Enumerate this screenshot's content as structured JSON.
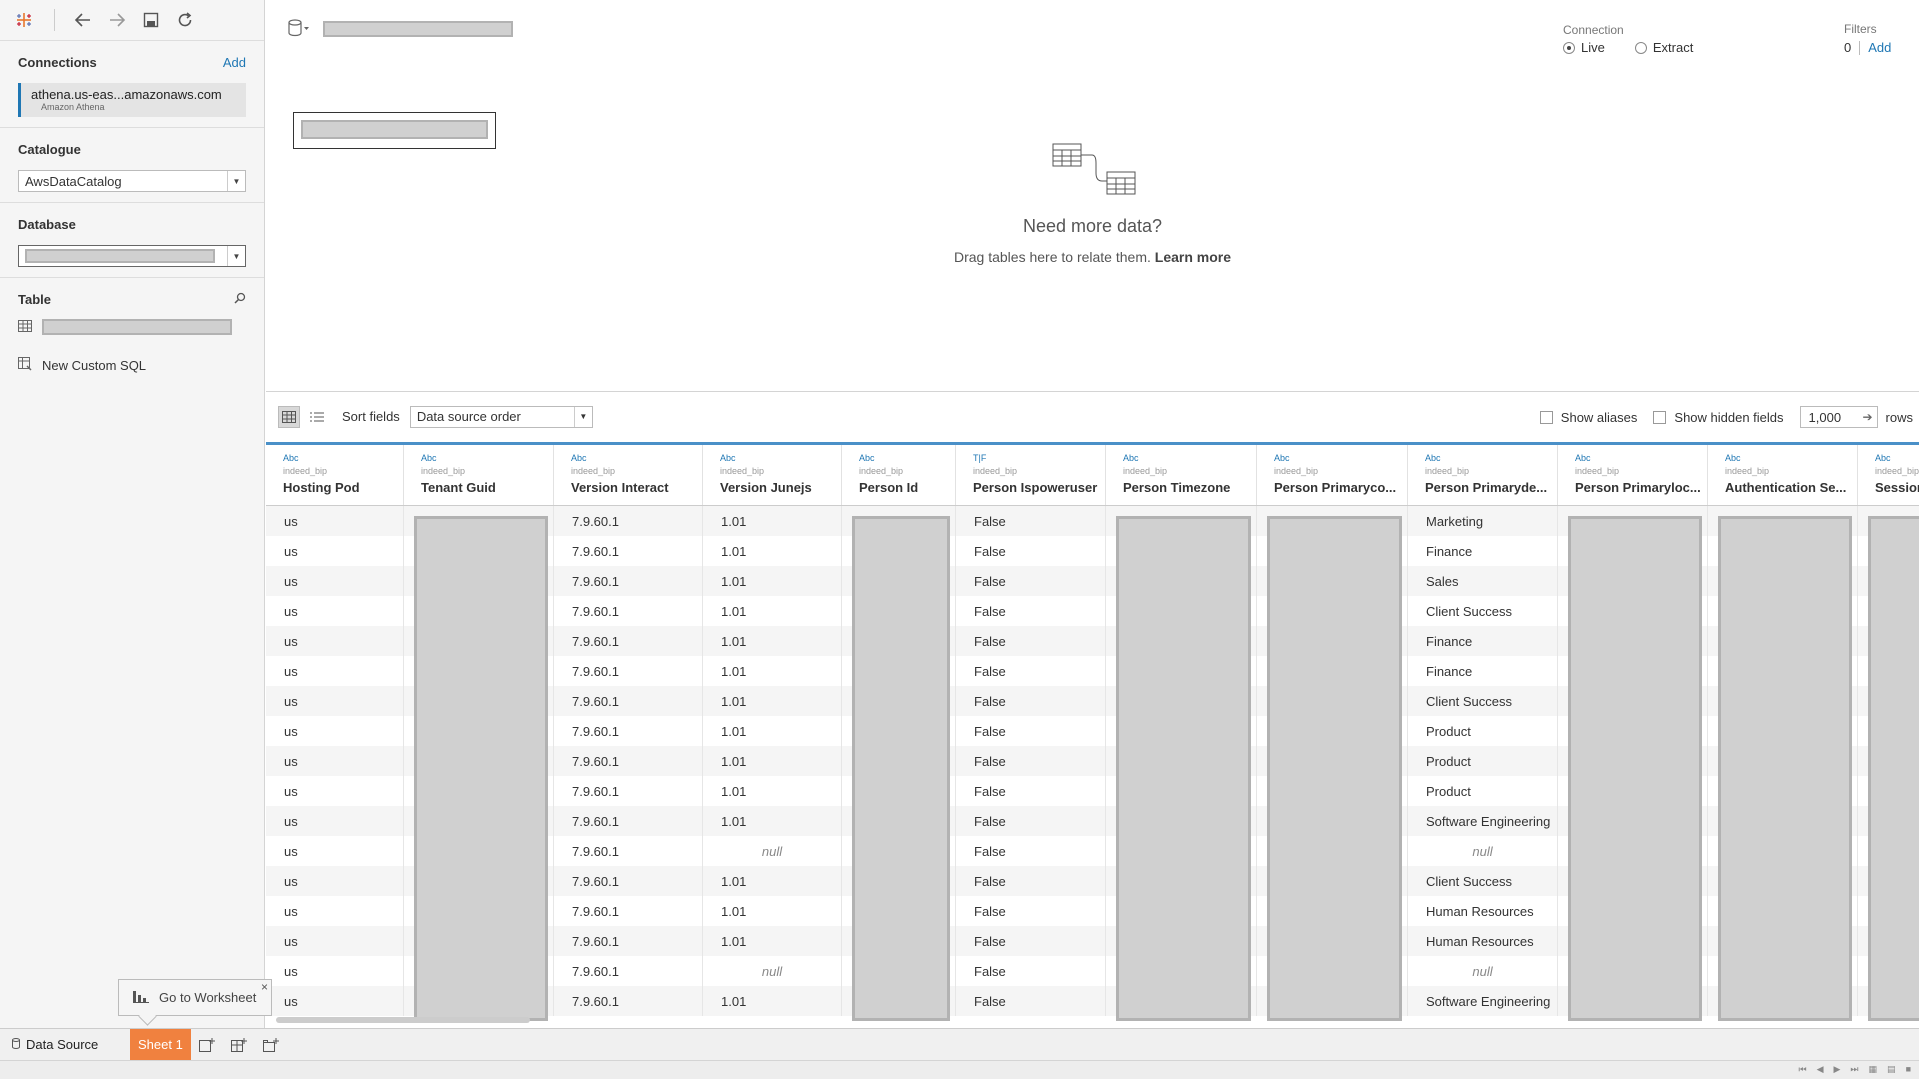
{
  "left_pane": {
    "connections_title": "Connections",
    "connections_add": "Add",
    "connection_name": "athena.us-eas...amazonaws.com",
    "connection_type": "Amazon Athena",
    "catalogue_title": "Catalogue",
    "catalogue_value": "AwsDataCatalog",
    "database_title": "Database",
    "table_title": "Table",
    "new_custom_sql": "New Custom SQL"
  },
  "canvas": {
    "connection_label": "Connection",
    "live_label": "Live",
    "extract_label": "Extract",
    "filters_label": "Filters",
    "filters_count": "0",
    "filters_add": "Add",
    "need_more_title": "Need more data?",
    "need_more_text": "Drag tables here to relate them.",
    "learn_more": "Learn more"
  },
  "grid_toolbar": {
    "sort_label": "Sort fields",
    "sort_value": "Data source order",
    "show_aliases": "Show aliases",
    "show_hidden": "Show hidden fields",
    "rows_value": "1,000",
    "rows_label": "rows"
  },
  "columns": [
    {
      "type": "Abc",
      "source": "indeed_bip",
      "name": "Hosting Pod"
    },
    {
      "type": "Abc",
      "source": "indeed_bip",
      "name": "Tenant Guid"
    },
    {
      "type": "Abc",
      "source": "indeed_bip",
      "name": "Version Interact"
    },
    {
      "type": "Abc",
      "source": "indeed_bip",
      "name": "Version Junejs"
    },
    {
      "type": "Abc",
      "source": "indeed_bip",
      "name": "Person Id"
    },
    {
      "type": "T|F",
      "source": "indeed_bip",
      "name": "Person Ispoweruser"
    },
    {
      "type": "Abc",
      "source": "indeed_bip",
      "name": "Person Timezone"
    },
    {
      "type": "Abc",
      "source": "indeed_bip",
      "name": "Person Primaryco..."
    },
    {
      "type": "Abc",
      "source": "indeed_bip",
      "name": "Person Primaryde..."
    },
    {
      "type": "Abc",
      "source": "indeed_bip",
      "name": "Person Primaryloc..."
    },
    {
      "type": "Abc",
      "source": "indeed_bip",
      "name": "Authentication Se..."
    },
    {
      "type": "Abc",
      "source": "indeed_bip",
      "name": "Session In"
    }
  ],
  "rows": [
    [
      "us",
      "",
      "7.9.60.1",
      "1.01",
      "",
      "False",
      "",
      "",
      "Marketing",
      "",
      "",
      ""
    ],
    [
      "us",
      "",
      "7.9.60.1",
      "1.01",
      "",
      "False",
      "",
      "",
      "Finance",
      "",
      "",
      ""
    ],
    [
      "us",
      "",
      "7.9.60.1",
      "1.01",
      "",
      "False",
      "",
      "",
      "Sales",
      "",
      "",
      ""
    ],
    [
      "us",
      "",
      "7.9.60.1",
      "1.01",
      "",
      "False",
      "",
      "",
      "Client Success",
      "",
      "",
      ""
    ],
    [
      "us",
      "",
      "7.9.60.1",
      "1.01",
      "",
      "False",
      "",
      "",
      "Finance",
      "",
      "",
      ""
    ],
    [
      "us",
      "",
      "7.9.60.1",
      "1.01",
      "",
      "False",
      "",
      "",
      "Finance",
      "",
      "",
      ""
    ],
    [
      "us",
      "",
      "7.9.60.1",
      "1.01",
      "",
      "False",
      "",
      "",
      "Client Success",
      "",
      "",
      ""
    ],
    [
      "us",
      "",
      "7.9.60.1",
      "1.01",
      "",
      "False",
      "",
      "",
      "Product",
      "",
      "",
      ""
    ],
    [
      "us",
      "",
      "7.9.60.1",
      "1.01",
      "",
      "False",
      "",
      "",
      "Product",
      "",
      "",
      ""
    ],
    [
      "us",
      "",
      "7.9.60.1",
      "1.01",
      "",
      "False",
      "",
      "",
      "Product",
      "",
      "",
      ""
    ],
    [
      "us",
      "",
      "7.9.60.1",
      "1.01",
      "",
      "False",
      "",
      "",
      "Software Engineering",
      "",
      "",
      ""
    ],
    [
      "us",
      "",
      "7.9.60.1",
      "null",
      "",
      "False",
      "",
      "",
      "null",
      "",
      "",
      ""
    ],
    [
      "us",
      "",
      "7.9.60.1",
      "1.01",
      "",
      "False",
      "",
      "",
      "Client Success",
      "",
      "",
      ""
    ],
    [
      "us",
      "",
      "7.9.60.1",
      "1.01",
      "",
      "False",
      "",
      "",
      "Human Resources",
      "",
      "",
      ""
    ],
    [
      "us",
      "",
      "7.9.60.1",
      "1.01",
      "",
      "False",
      "",
      "",
      "Human Resources",
      "",
      "",
      ""
    ],
    [
      "us",
      "",
      "7.9.60.1",
      "null",
      "",
      "False",
      "",
      "",
      "null",
      "",
      "",
      ""
    ],
    [
      "us",
      "",
      "7.9.60.1",
      "1.01",
      "",
      "False",
      "",
      "",
      "Software Engineering",
      "",
      "",
      ""
    ]
  ],
  "tabs": {
    "data_source": "Data Source",
    "sheet1": "Sheet 1"
  },
  "tooltip": {
    "goto_worksheet": "Go to Worksheet",
    "close": "×"
  },
  "colors": {
    "accent": "#1f77b4",
    "sheet_tab": "#f0813f",
    "grid_top_border": "#4a90c8"
  }
}
